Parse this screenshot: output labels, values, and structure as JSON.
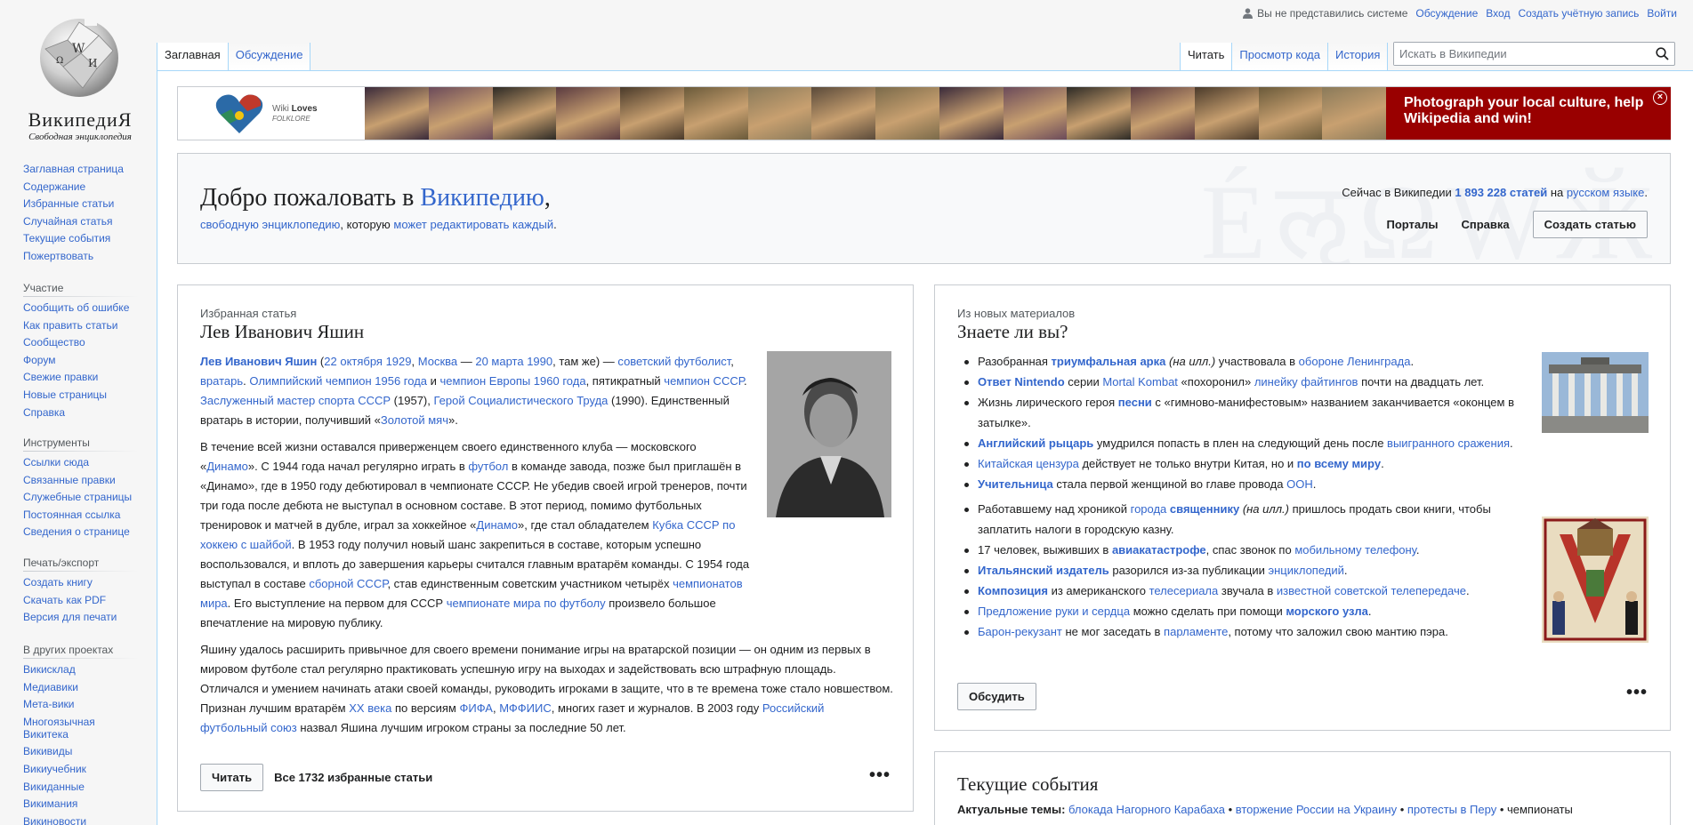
{
  "logo": {
    "wordmark": "ВикипедиЯ",
    "tagline": "Свободная энциклопедия"
  },
  "sidebar": {
    "main": [
      "Заглавная страница",
      "Содержание",
      "Избранные статьи",
      "Случайная статья",
      "Текущие события",
      "Пожертвовать"
    ],
    "participation": {
      "title": "Участие",
      "items": [
        "Сообщить об ошибке",
        "Как править статьи",
        "Сообщество",
        "Форум",
        "Свежие правки",
        "Новые страницы",
        "Справка"
      ]
    },
    "tools": {
      "title": "Инструменты",
      "items": [
        "Ссылки сюда",
        "Связанные правки",
        "Служебные страницы",
        "Постоянная ссылка",
        "Сведения о странице"
      ]
    },
    "print": {
      "title": "Печать/экспорт",
      "items": [
        "Создать книгу",
        "Скачать как PDF",
        "Версия для печати"
      ]
    },
    "projects": {
      "title": "В других проектах",
      "items": [
        "Викисклад",
        "Медиавики",
        "Мета-вики",
        "Многоязычная Викитека",
        "Викивиды",
        "Викиучебник",
        "Викиданные",
        "Викимания",
        "Викиновости"
      ]
    }
  },
  "personal": {
    "anon": "Вы не представились системе",
    "talk": "Обсуждение",
    "login": "Вход",
    "create": "Создать учётную запись",
    "logout": "Войти"
  },
  "tabs": {
    "main": "Заглавная",
    "discussion": "Обсуждение",
    "read": "Читать",
    "source": "Просмотр кода",
    "history": "История"
  },
  "search": {
    "placeholder": "Искать в Википедии",
    "icon": "search-icon"
  },
  "banner": {
    "wl": "Wiki",
    "loves": "Loves",
    "folklore": "FOLKLORE",
    "cta": "Photograph your local culture, help Wikipedia and win!",
    "close": "×",
    "photo_colors": [
      "#3a2a3a",
      "#6b4a5a",
      "#2d2a25",
      "#5a3a40",
      "#4a3a2a",
      "#6a5a3a",
      "#8a7a5a",
      "#5a4a3a",
      "#7a6a4a",
      "#3a2a3a",
      "#6b4a5a",
      "#2d2a25",
      "#5a3a40",
      "#4a3a2a",
      "#6a5a3a",
      "#8a7a5a"
    ]
  },
  "welcome": {
    "title_prefix": "Добро пожаловать в ",
    "title_link": "Википедию",
    "title_suffix": ",",
    "sub_link1": "свободную энциклопедию",
    "sub_mid": ", которую ",
    "sub_link2": "может редактировать каждый",
    "sub_end": ".",
    "count_prefix": "Сейчас в Википедии ",
    "count_value": "1 893 228 статей",
    "count_mid": " на ",
    "count_lang": "русском языке",
    "count_end": ".",
    "portals": "Порталы",
    "help": "Справка",
    "create": "Создать статью",
    "watermark": "ÉऌΩWӁ"
  },
  "featured": {
    "kicker": "Избранная статья",
    "title": "Лев Иванович Яшин",
    "read_button": "Читать",
    "all_link": "Все 1732 избранные статьи",
    "more": "•••"
  },
  "dyk": {
    "kicker": "Из новых материалов",
    "title": "Знаете ли вы?",
    "discuss": "Обсудить",
    "more": "•••"
  },
  "current": {
    "title": "Текущие события",
    "topics_label": "Актуальные темы:",
    "topics": [
      "блокада Нагорного Карабаха",
      "вторжение России на Украину",
      "протесты в Перу"
    ],
    "topics_tail": " • чемпионаты"
  }
}
